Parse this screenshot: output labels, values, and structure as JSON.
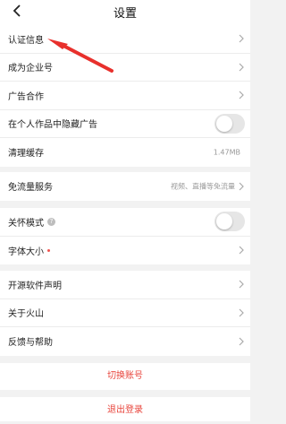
{
  "header": {
    "title": "设置",
    "back_icon": "chevron-left-icon"
  },
  "groups": {
    "account": {
      "verify": "认证信息",
      "enterprise": "成为企业号",
      "ads": "广告合作",
      "hide_ads": "在个人作品中隐藏广告",
      "cache": "清理缓存",
      "cache_size": "1.47MB"
    },
    "data": {
      "free_traffic": "免流量服务",
      "free_traffic_hint": "视频、直播等免流量"
    },
    "display": {
      "care_mode": "关怀模式",
      "font_size": "字体大小"
    },
    "about": {
      "open_source": "开源软件声明",
      "about": "关于火山",
      "feedback": "反馈与帮助"
    }
  },
  "actions": {
    "switch_account": "切换账号",
    "logout": "退出登录"
  },
  "toggles": {
    "hide_ads": false,
    "care_mode": false
  },
  "colors": {
    "accent": "#e8453c",
    "annotation_arrow": "#e8302c",
    "toggle_off": "#e6e6e6"
  }
}
